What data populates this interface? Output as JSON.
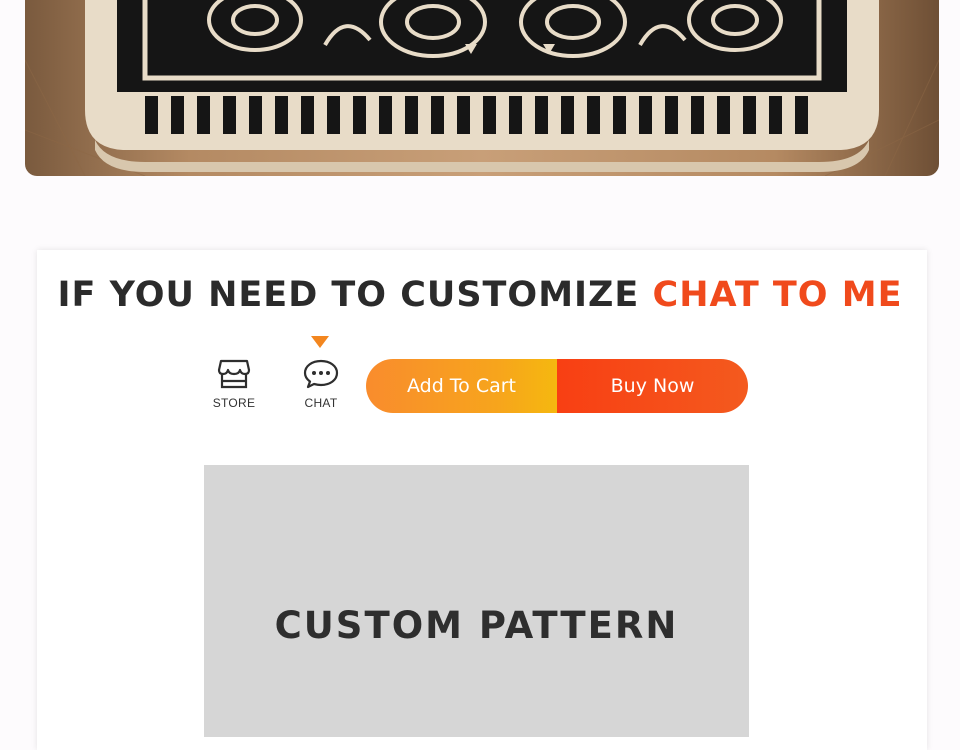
{
  "hero": {
    "alt": "door mat product photo"
  },
  "promo": {
    "headline_prefix": "IF YOU NEED TO CUSTOMIZE",
    "headline_accent": "CHAT TO ME",
    "accent_color": "#f04a1c",
    "store_label": "STORE",
    "chat_label": "CHAT",
    "add_to_cart": "Add To Cart",
    "buy_now": "Buy Now",
    "custom_pattern": "CUSTOM PATTERN"
  },
  "colors": {
    "cart_gradient": [
      "#f98c2d",
      "#f5b80f"
    ],
    "buy_gradient": [
      "#f83f13",
      "#f45a1e"
    ],
    "pointer": "#f3861f"
  },
  "icons": {
    "store": "store-icon",
    "chat": "chat-bubble-icon",
    "pointer": "triangle-down-icon"
  }
}
